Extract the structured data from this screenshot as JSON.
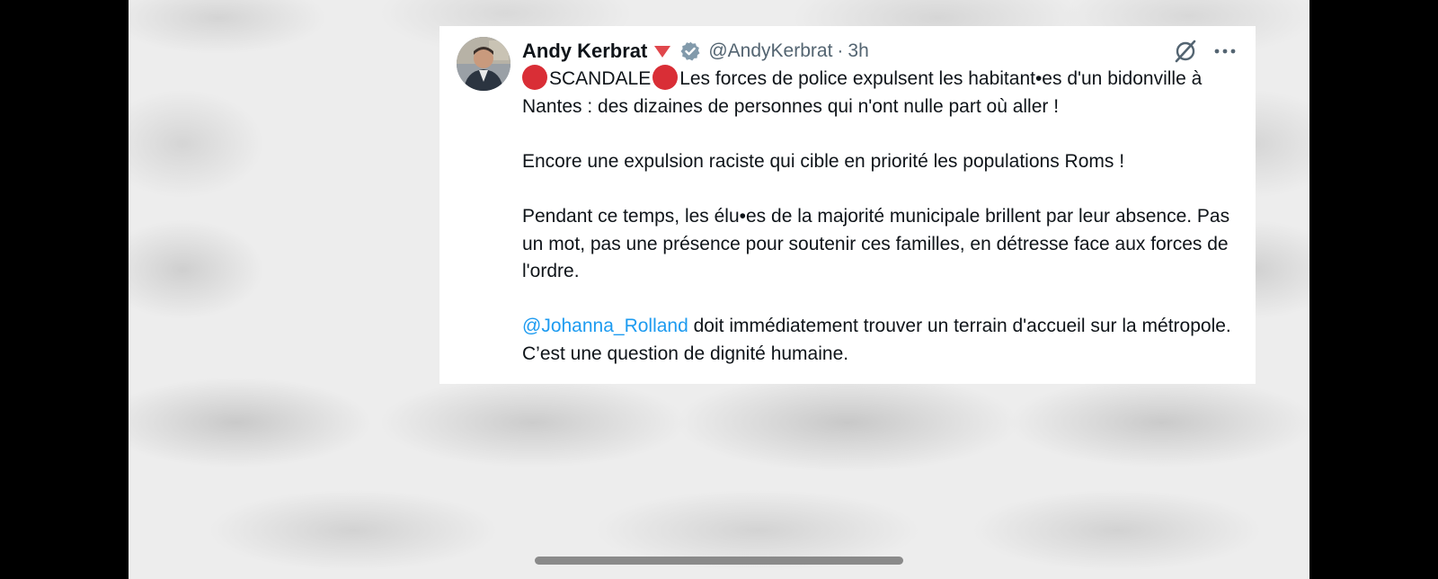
{
  "tweet": {
    "author": {
      "name": "Andy Kerbrat",
      "handle": "@AndyKerbrat",
      "timestamp": "3h",
      "separator": "·",
      "party_icon": "red-triangle-down-icon",
      "verified_icon": "verified-badge-icon",
      "verified_color": "#829aab",
      "party_color": "#e0474c"
    },
    "actions": {
      "grok_icon": "grok-icon",
      "more_icon": "more-icon"
    },
    "body": {
      "line1_word": "SCANDALE",
      "line1_rest": "Les forces de police expulsent les habitant•es d'un bidonville à Nantes : des dizaines de personnes qui n'ont nulle part où aller !",
      "para2": "Encore une expulsion raciste qui cible en priorité les populations Roms !",
      "para3": "Pendant ce temps, les élu•es de la majorité municipale brillent par leur absence. Pas un mot, pas une présence pour soutenir ces familles, en détresse face aux forces de l'ordre.",
      "mention": "@Johanna_Rolland",
      "para4_rest": " doit immédiatement trouver un terrain d'accueil sur la métropole. C’est une question de dignité humaine.",
      "red_dot_color": "#d92e36",
      "mention_color": "#1d9bf0"
    }
  },
  "system": {
    "home_indicator": "home-indicator"
  }
}
